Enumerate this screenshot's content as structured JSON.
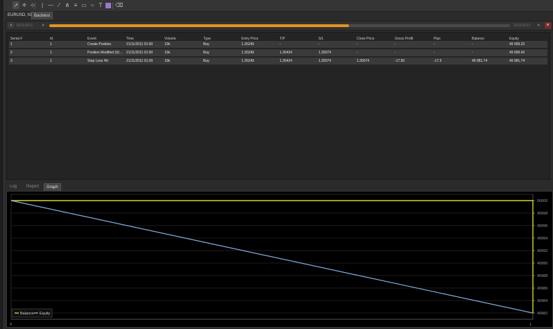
{
  "toolbar": {
    "icons": [
      "cursor-icon",
      "crosshair-icon",
      "zoom-icon",
      "vertical-line-icon",
      "horizontal-line-icon",
      "trendline-icon",
      "pitchfork-icon",
      "fibonacci-icon",
      "rectangle-icon",
      "ellipse-icon",
      "text-icon",
      "color-swatch-icon",
      "clear-icon"
    ],
    "colors": {
      "swatch": "#9a78c8"
    }
  },
  "tabs": [
    {
      "label": "EURUSD, h1",
      "active": false
    },
    {
      "label": "Backtest",
      "active": true
    }
  ],
  "timeline": {
    "start_date": "20/11/2011",
    "end_date": "20/11/2012",
    "progress": 0.65
  },
  "trades": {
    "columns": [
      "Serial #",
      "Id",
      "Event",
      "Time",
      "Volume",
      "Type",
      "Entry Price",
      "T/P",
      "S/L",
      "Close Price",
      "Gross Profit",
      "Pips",
      "Balance",
      "Equity"
    ],
    "rows": [
      [
        "1",
        "1",
        "Create Position",
        "21/11/2011 01:00",
        "10k",
        "Buy",
        "1.35249",
        "-",
        "-",
        "-",
        "-",
        "-",
        "-",
        "49 999.32"
      ],
      [
        "2",
        "1",
        "Position Modified (S/...",
        "21/11/2011 01:00",
        "10k",
        "Buy",
        "1.35249",
        "1.35424",
        "1.35074",
        "-",
        "-",
        "-",
        "-",
        "49 999.42"
      ],
      [
        "3",
        "1",
        "Stop Loss Hit",
        "21/11/2011 01:09",
        "10k",
        "Buy",
        "1.35249",
        "1.35424",
        "1.35074",
        "1.35074",
        "-17.50",
        "-17.5",
        "49 981.74",
        "49 981.74"
      ]
    ]
  },
  "bottom_tabs": [
    {
      "label": "Log",
      "active": false
    },
    {
      "label": "Report",
      "active": false
    },
    {
      "label": "Graph",
      "active": true
    }
  ],
  "chart_data": {
    "type": "line",
    "x": [
      0,
      1
    ],
    "series": [
      {
        "name": "Balance",
        "color": "#d8d81e",
        "values": [
          50000,
          50000
        ],
        "drop_at_end_to": 49982
      },
      {
        "name": "Equity",
        "color": "#7fb2e0",
        "values": [
          50000,
          49982
        ]
      }
    ],
    "y_ticks": [
      50000,
      49998,
      49996,
      49994,
      49992,
      49990,
      49988,
      49986,
      49984,
      49982
    ],
    "x_ticks": [
      0,
      1
    ],
    "ylim": [
      49981,
      50001
    ],
    "xlim": [
      0,
      1
    ],
    "grid": true,
    "legend_position": "bottom-left"
  }
}
